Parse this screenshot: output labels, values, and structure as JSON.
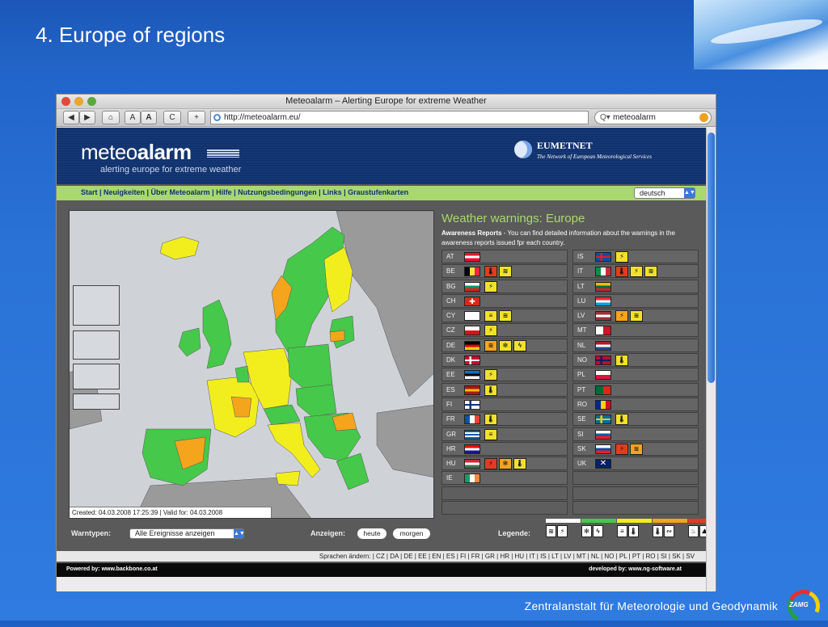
{
  "slide": {
    "title": "4. Europe of regions",
    "footer": "Zentralanstalt für Meteorologie und Geodynamik",
    "logo_text": "ZAMG"
  },
  "browser": {
    "window_title": "Meteoalarm – Alerting Europe for extreme Weather",
    "url": "http://meteoalarm.eu/",
    "search_value": "meteoalarm",
    "buttons": {
      "back": "◀",
      "forward": "▶",
      "home": "⌂",
      "text_smaller": "A",
      "text_larger": "A",
      "reload": "C",
      "add": "+"
    }
  },
  "site": {
    "logo_light": "meteo",
    "logo_bold": "alarm",
    "tagline": "alerting europe for extreme weather",
    "partner_name": "EUMETNET",
    "partner_sub": "The Network of European Meteorological Services",
    "nav_links": "Start | Neuigkeiten | Über Meteoalarm | Hilfe | Nutzungsbedingungen | Links | Graustufenkarten",
    "language": "deutsch",
    "map_caption": "Created: 04.03.2008  17:25:39  | Valid for: 04.03.2008",
    "warnings_title": "Weather warnings: Europe",
    "awareness_label": "Awareness Reports",
    "awareness_text": " - You can find detailed information about the warnings in the awareness reports issued fpr each country.",
    "warntypen_label": "Warntypen:",
    "warntypen_value": "Alle Ereignisse anzeigen",
    "anzeigen_label": "Anzeigen:",
    "heute": "heute",
    "morgen": "morgen",
    "legende_label": "Legende:",
    "languages_bar": "Sprachen ändern: | CZ | DA | DE | EE | EN | ES | FI | FR | GR | HR | HU | IT | IS | LT | LV | MT | NL | NO | PL | PT | RO | SI | SK | SV",
    "powered_by": "Powered by: www.backbone.co.at",
    "developed_by": "developed by: www.ng-software.at"
  },
  "colors": {
    "green": "#46c84a",
    "yellow": "#f2ee1e",
    "orange": "#f4a51c",
    "red": "#e43b20",
    "sea": "#cfd3d8",
    "land_grey": "#9a9a9a"
  },
  "countries_left": [
    {
      "code": "AT",
      "flag": [
        "#e8112d",
        "#ffffff",
        "#e8112d"
      ],
      "dir": "h",
      "warnings": []
    },
    {
      "code": "BE",
      "flag": [
        "#000000",
        "#fae042",
        "#ed2939"
      ],
      "dir": "v",
      "warnings": [
        {
          "level": "red",
          "icon": "thermometer"
        },
        {
          "level": "yellow",
          "icon": "wind"
        }
      ]
    },
    {
      "code": "BG",
      "flag": [
        "#ffffff",
        "#00966e",
        "#d62612"
      ],
      "dir": "h",
      "warnings": [
        {
          "level": "yellow",
          "icon": "thunderstorm"
        }
      ]
    },
    {
      "code": "CH",
      "flag": [
        "#d52b1e"
      ],
      "dir": "h",
      "cross": true,
      "warnings": []
    },
    {
      "code": "CY",
      "flag": [
        "#ffffff"
      ],
      "dir": "h",
      "warnings": [
        {
          "level": "yellow",
          "icon": "fog"
        },
        {
          "level": "yellow",
          "icon": "wind"
        }
      ]
    },
    {
      "code": "CZ",
      "flag": [
        "#ffffff",
        "#d7141a"
      ],
      "dir": "h",
      "tri": true,
      "warnings": [
        {
          "level": "yellow",
          "icon": "thunderstorm"
        }
      ]
    },
    {
      "code": "DE",
      "flag": [
        "#000000",
        "#dd0000",
        "#ffce00"
      ],
      "dir": "h",
      "warnings": [
        {
          "level": "orange",
          "icon": "wind"
        },
        {
          "level": "yellow",
          "icon": "snow"
        },
        {
          "level": "yellow",
          "icon": "lightning"
        }
      ]
    },
    {
      "code": "DK",
      "flag": [
        "#c60c30"
      ],
      "dir": "h",
      "nordic": "#ffffff",
      "warnings": []
    },
    {
      "code": "EE",
      "flag": [
        "#0072ce",
        "#000000",
        "#ffffff"
      ],
      "dir": "h",
      "warnings": [
        {
          "level": "yellow",
          "icon": "thunderstorm"
        }
      ]
    },
    {
      "code": "ES",
      "flag": [
        "#aa151b",
        "#f1bf00",
        "#aa151b"
      ],
      "dir": "h",
      "warnings": [
        {
          "level": "yellow",
          "icon": "thermometer"
        }
      ]
    },
    {
      "code": "FI",
      "flag": [
        "#ffffff"
      ],
      "dir": "h",
      "nordic": "#003580",
      "warnings": []
    },
    {
      "code": "FR",
      "flag": [
        "#0055a4",
        "#ffffff",
        "#ef4135"
      ],
      "dir": "v",
      "warnings": [
        {
          "level": "yellow",
          "icon": "thermometer"
        }
      ]
    },
    {
      "code": "GR",
      "flag": [
        "#0d5eaf",
        "#ffffff",
        "#0d5eaf",
        "#ffffff",
        "#0d5eaf"
      ],
      "dir": "h",
      "warnings": [
        {
          "level": "yellow",
          "icon": "fog"
        }
      ]
    },
    {
      "code": "HR",
      "flag": [
        "#ff0000",
        "#ffffff",
        "#171796"
      ],
      "dir": "h",
      "warnings": []
    },
    {
      "code": "HU",
      "flag": [
        "#ce2939",
        "#ffffff",
        "#477050"
      ],
      "dir": "h",
      "warnings": [
        {
          "level": "red",
          "icon": "thunderstorm"
        },
        {
          "level": "orange",
          "icon": "snow"
        },
        {
          "level": "yellow",
          "icon": "thermometer"
        }
      ]
    },
    {
      "code": "IE",
      "flag": [
        "#169b62",
        "#ffffff",
        "#ff883e"
      ],
      "dir": "v",
      "warnings": []
    },
    {
      "code": "",
      "flag": [],
      "dir": "h",
      "warnings": []
    },
    {
      "code": "",
      "flag": [],
      "dir": "h",
      "warnings": []
    }
  ],
  "countries_right": [
    {
      "code": "IS",
      "flag": [
        "#02529c"
      ],
      "dir": "h",
      "nordic": "#dc1e35",
      "warnings": [
        {
          "level": "yellow",
          "icon": "thunderstorm"
        }
      ]
    },
    {
      "code": "IT",
      "flag": [
        "#009246",
        "#ffffff",
        "#ce2b37"
      ],
      "dir": "v",
      "warnings": [
        {
          "level": "red",
          "icon": "thermometer"
        },
        {
          "level": "yellow",
          "icon": "thunderstorm"
        },
        {
          "level": "yellow",
          "icon": "wind"
        }
      ]
    },
    {
      "code": "LT",
      "flag": [
        "#fdb913",
        "#006a44",
        "#c1272d"
      ],
      "dir": "h",
      "warnings": []
    },
    {
      "code": "LU",
      "flag": [
        "#ed2939",
        "#ffffff",
        "#00a1de"
      ],
      "dir": "h",
      "warnings": []
    },
    {
      "code": "LV",
      "flag": [
        "#9e3039",
        "#ffffff",
        "#9e3039"
      ],
      "dir": "h",
      "warnings": [
        {
          "level": "orange",
          "icon": "thunderstorm"
        },
        {
          "level": "yellow",
          "icon": "wind"
        }
      ]
    },
    {
      "code": "MT",
      "flag": [
        "#ffffff",
        "#cf142b"
      ],
      "dir": "v",
      "warnings": []
    },
    {
      "code": "NL",
      "flag": [
        "#ae1c28",
        "#ffffff",
        "#21468b"
      ],
      "dir": "h",
      "warnings": []
    },
    {
      "code": "NO",
      "flag": [
        "#ba0c2f"
      ],
      "dir": "h",
      "nordic": "#00205b",
      "warnings": [
        {
          "level": "yellow",
          "icon": "thermometer"
        }
      ]
    },
    {
      "code": "PL",
      "flag": [
        "#ffffff",
        "#dc143c"
      ],
      "dir": "h",
      "warnings": []
    },
    {
      "code": "PT",
      "flag": [
        "#046a38",
        "#da291c"
      ],
      "dir": "v",
      "warnings": []
    },
    {
      "code": "RO",
      "flag": [
        "#002b7f",
        "#fcd116",
        "#ce1126"
      ],
      "dir": "v",
      "warnings": []
    },
    {
      "code": "SE",
      "flag": [
        "#006aa7"
      ],
      "dir": "h",
      "nordic": "#fecc00",
      "warnings": [
        {
          "level": "yellow",
          "icon": "thermometer"
        }
      ]
    },
    {
      "code": "SI",
      "flag": [
        "#ffffff",
        "#005da4",
        "#ed1c24"
      ],
      "dir": "h",
      "warnings": []
    },
    {
      "code": "SK",
      "flag": [
        "#ffffff",
        "#0b4ea2",
        "#ee1c25"
      ],
      "dir": "h",
      "warnings": [
        {
          "level": "red",
          "icon": "thunderstorm"
        },
        {
          "level": "orange",
          "icon": "wind"
        }
      ]
    },
    {
      "code": "UK",
      "flag": [
        "#012169"
      ],
      "dir": "h",
      "union": true,
      "warnings": []
    },
    {
      "code": "",
      "flag": [],
      "dir": "h",
      "warnings": []
    },
    {
      "code": "",
      "flag": [],
      "dir": "h",
      "warnings": []
    },
    {
      "code": "",
      "flag": [],
      "dir": "h",
      "warnings": []
    }
  ],
  "legend": {
    "levels": [
      "white",
      "green",
      "yellow",
      "orange",
      "red"
    ],
    "icons": [
      {
        "name": "wind",
        "glyph": "≋"
      },
      {
        "name": "thunderstorm",
        "glyph": "⚡"
      },
      {
        "name": "snow",
        "glyph": "✻"
      },
      {
        "name": "lightning",
        "glyph": "ϟ"
      },
      {
        "name": "fog",
        "glyph": "≡"
      },
      {
        "name": "extreme-high-temperature",
        "glyph": "🌡"
      },
      {
        "name": "extreme-low-temperature",
        "glyph": "🌡"
      },
      {
        "name": "coastal-event",
        "glyph": "∾"
      },
      {
        "name": "forest-fire",
        "glyph": "♨"
      },
      {
        "name": "avalanche",
        "glyph": "⛰"
      }
    ]
  },
  "icon_glyphs": {
    "thermometer": "🌡",
    "wind": "≋",
    "thunderstorm": "⚡",
    "snow": "✻",
    "lightning": "ϟ",
    "fog": "≡"
  }
}
